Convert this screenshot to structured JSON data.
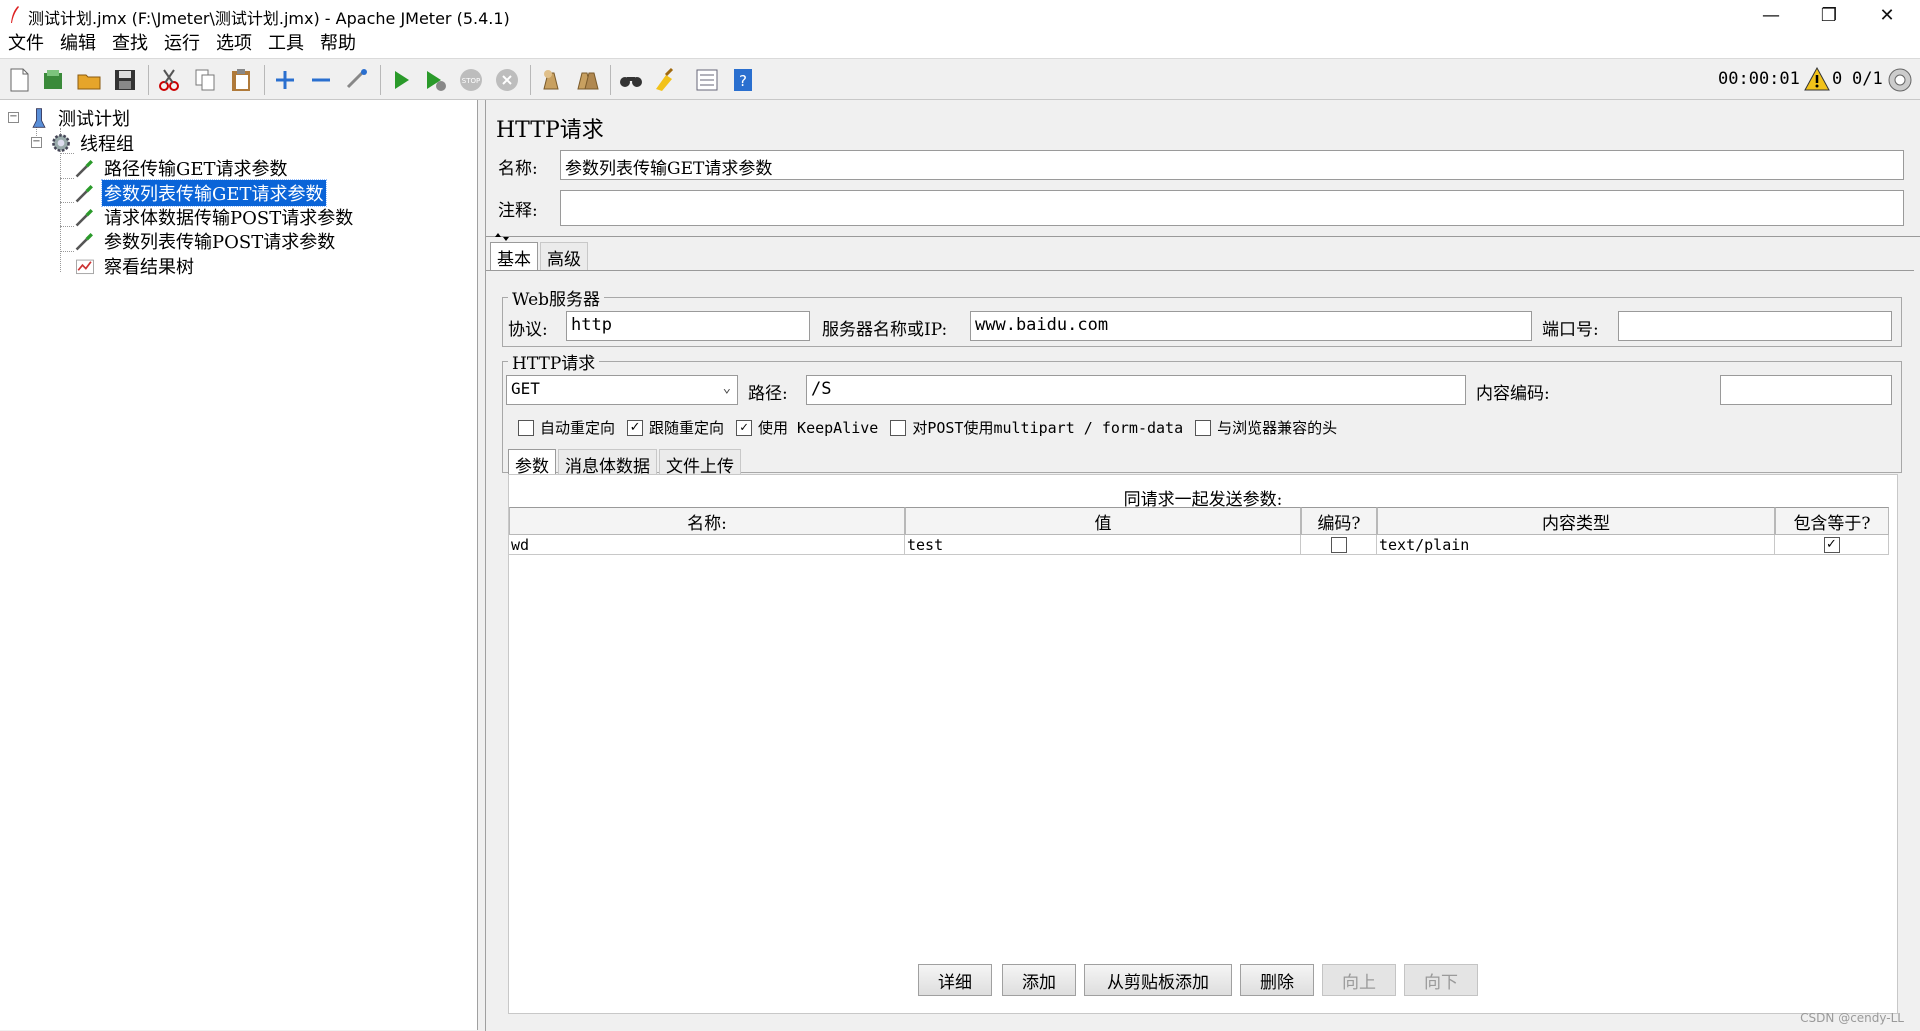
{
  "window": {
    "title": "测试计划.jmx (F:\\Jmeter\\测试计划.jmx) - Apache JMeter (5.4.1)",
    "minimize_glyph": "—",
    "maximize_glyph": "❐",
    "close_glyph": "✕"
  },
  "menu": [
    "文件",
    "编辑",
    "查找",
    "运行",
    "选项",
    "工具",
    "帮助"
  ],
  "toolbar": {
    "icons": [
      "new-icon",
      "templates-icon",
      "open-icon",
      "save-icon",
      "cut-icon",
      "copy-icon",
      "paste-icon",
      "expand-icon",
      "collapse-icon",
      "toggle-icon",
      "start-icon",
      "start-no-pause-icon",
      "stop-icon",
      "shutdown-icon",
      "clear-icon",
      "clear-all-icon",
      "search-icon",
      "reset-search-icon",
      "function-helper-icon",
      "help-icon"
    ],
    "timer": "00:00:01",
    "warning_count": "0",
    "thread_count": "0/1"
  },
  "tree": {
    "root": "测试计划",
    "thread_group": "线程组",
    "items": [
      "路径传输GET请求参数",
      "参数列表传输GET请求参数",
      "请求体数据传输POST请求参数",
      "参数列表传输POST请求参数",
      "察看结果树"
    ],
    "selected_index": 1
  },
  "http": {
    "panel_title": "HTTP请求",
    "name_label": "名称:",
    "name_value": "参数列表传输GET请求参数",
    "comment_label": "注释:",
    "comment_value": "",
    "tabs": [
      "基本",
      "高级"
    ],
    "web_server": {
      "group_title": "Web服务器",
      "protocol_label": "协议:",
      "protocol_value": "http",
      "server_label": "服务器名称或IP:",
      "server_value": "www.baidu.com",
      "port_label": "端口号:",
      "port_value": ""
    },
    "request": {
      "group_title": "HTTP请求",
      "method": "GET",
      "path_label": "路径:",
      "path_value": "/S",
      "encoding_label": "内容编码:",
      "encoding_value": ""
    },
    "options": [
      {
        "label": "自动重定向",
        "checked": false
      },
      {
        "label": "跟随重定向",
        "checked": true
      },
      {
        "label": "使用 KeepAlive",
        "checked": true
      },
      {
        "label": "对POST使用multipart / form-data",
        "checked": false
      },
      {
        "label": "与浏览器兼容的头",
        "checked": false
      }
    ],
    "sub_tabs": [
      "参数",
      "消息体数据",
      "文件上传"
    ],
    "params": {
      "caption": "同请求一起发送参数:",
      "headers": [
        "名称:",
        "值",
        "编码?",
        "内容类型",
        "包含等于?"
      ],
      "rows": [
        {
          "name": "wd",
          "value": "test",
          "encode": false,
          "content_type": "text/plain",
          "include_equals": true
        }
      ]
    },
    "buttons": [
      {
        "label": "详细",
        "enabled": true
      },
      {
        "label": "添加",
        "enabled": true
      },
      {
        "label": "从剪贴板添加",
        "enabled": true
      },
      {
        "label": "删除",
        "enabled": true
      },
      {
        "label": "向上",
        "enabled": false
      },
      {
        "label": "向下",
        "enabled": false
      }
    ]
  },
  "watermark": "CSDN @cendy-LL"
}
